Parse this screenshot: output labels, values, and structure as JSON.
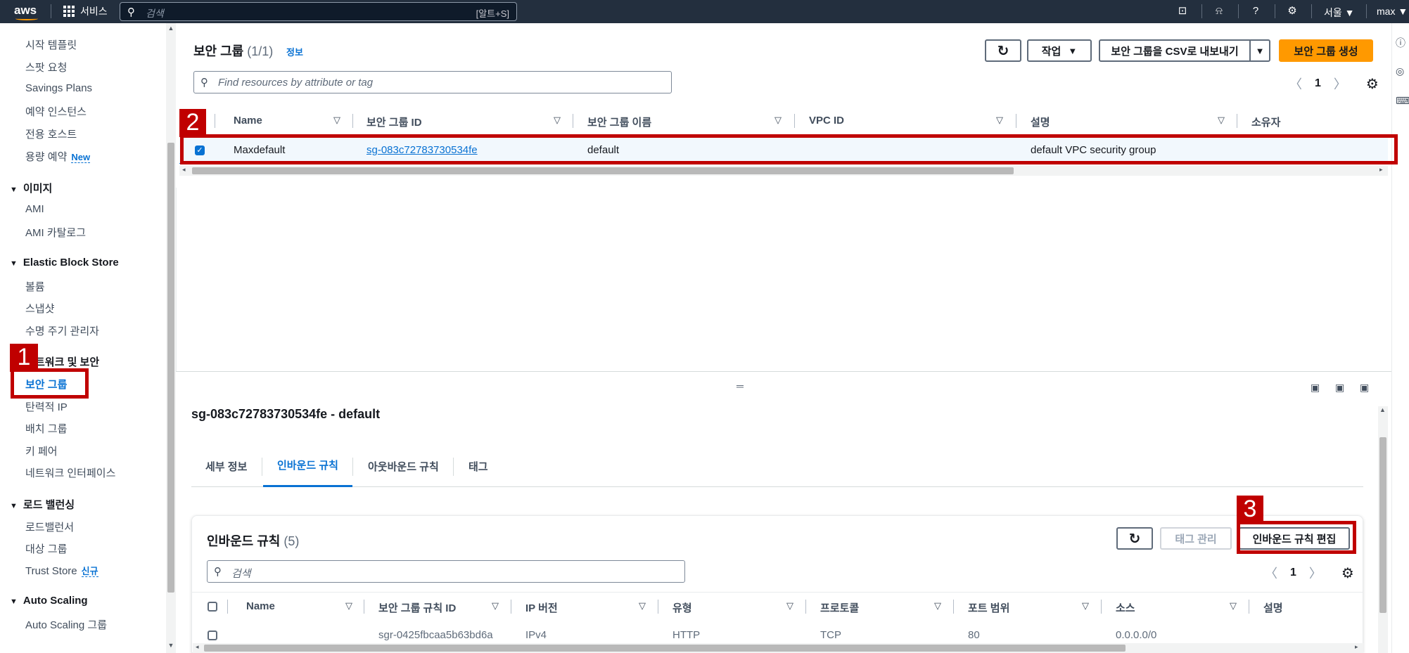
{
  "topbar": {
    "logo": "aws",
    "services_label": "서비스",
    "search_placeholder": "검색",
    "search_shortcut": "[알트+S]",
    "region": "서울 ▼",
    "user": "max ▼",
    "icons": [
      "cloudshell-icon",
      "bell-icon",
      "help-icon",
      "gear-icon"
    ]
  },
  "sidebar": {
    "items_top": [
      "시작 템플릿",
      "스팟 요청",
      "Savings Plans",
      "예약 인스턴스",
      "전용 호스트",
      "용량 예약"
    ],
    "new_badge": "New",
    "section_images": "이미지",
    "images_items": [
      "AMI",
      "AMI 카탈로그"
    ],
    "section_ebs": "Elastic Block Store",
    "ebs_items": [
      "볼륨",
      "스냅샷",
      "수명 주기 관리자"
    ],
    "section_network": "트워크 및 보안",
    "network_items": [
      "보안 그룹",
      "탄력적 IP",
      "배치 그룹",
      "키 페어",
      "네트워크 인터페이스"
    ],
    "section_lb": "로드 밸런싱",
    "lb_items": [
      "로드밸런서",
      "대상 그룹",
      "Trust Store"
    ],
    "new_badge_kr": "신규",
    "section_as": "Auto Scaling",
    "as_items": [
      "Auto Scaling 그룹"
    ]
  },
  "top_panel": {
    "title": "보안 그룹",
    "count": "(1/1)",
    "info": "정보",
    "actions_label": "작업",
    "export_label": "보안 그룹을 CSV로 내보내기",
    "create_label": "보안 그룹 생성",
    "filter_placeholder": "Find resources by attribute or tag",
    "page": "1",
    "columns": [
      "Name",
      "보안 그룹 ID",
      "보안 그룹 이름",
      "VPC ID",
      "설명",
      "소유자"
    ],
    "rows": [
      {
        "name": "Maxdefault",
        "sg_id": "sg-083c72783730534fe",
        "sg_name": "default",
        "vpc_id": "",
        "description": "default VPC security group",
        "owner": ""
      }
    ]
  },
  "detail": {
    "title": "sg-083c72783730534fe - default",
    "tabs": [
      "세부 정보",
      "인바운드 규칙",
      "아웃바운드 규칙",
      "태그"
    ],
    "active_tab": "인바운드 규칙",
    "inbound_title": "인바운드 규칙",
    "inbound_count": "(5)",
    "manage_tags_label": "태그 관리",
    "edit_inbound_label": "인바운드 규칙 편집",
    "search_placeholder": "검색",
    "page": "1",
    "columns": [
      "Name",
      "보안 그룹 규칙 ID",
      "IP 버전",
      "유형",
      "프로토콜",
      "포트 범위",
      "소스",
      "설명"
    ],
    "partial_row": [
      "sgr-0425fbcaa5b63bd6a",
      "IPv4",
      "HTTP",
      "TCP",
      "80",
      "0.0.0.0/0"
    ]
  },
  "annotations": [
    "1",
    "2",
    "3"
  ],
  "colors": {
    "accent": "#0972d3",
    "primary_button": "#ff9900",
    "annotation": "#c00000",
    "topbar": "#232f3e"
  }
}
